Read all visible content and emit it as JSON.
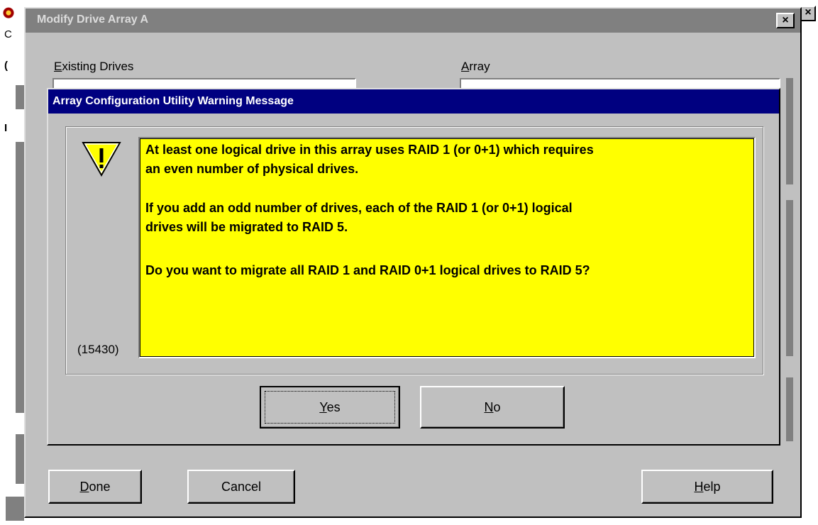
{
  "background": {
    "frag_top_label": "C",
    "frag_mid_label": "(",
    "frag_low_label": "I"
  },
  "modify_window": {
    "title": "Modify Drive Array A",
    "close_label": "×",
    "existing_drives_label": "Existing Drives",
    "array_label": "Array",
    "buttons": {
      "done": "Done",
      "cancel": "Cancel",
      "help": "Help"
    }
  },
  "warning": {
    "title": "Array Configuration Utility Warning Message",
    "icon": "warning-triangle-icon",
    "lines": [
      "At least one logical drive in this array uses RAID 1 (or 0+1) which requires",
      "an even number of physical drives.",
      "If you add an odd number of drives, each of the RAID 1 (or 0+1) logical",
      "drives will be migrated to RAID 5.",
      "Do you want to migrate all RAID 1 and RAID 0+1 logical drives to RAID 5?"
    ],
    "code": "(15430)",
    "buttons": {
      "yes": "Yes",
      "no": "No"
    }
  },
  "colors": {
    "message_bg": "#ffff00",
    "active_title": "#000080",
    "inactive_title": "#808080",
    "face": "#c0c0c0"
  }
}
